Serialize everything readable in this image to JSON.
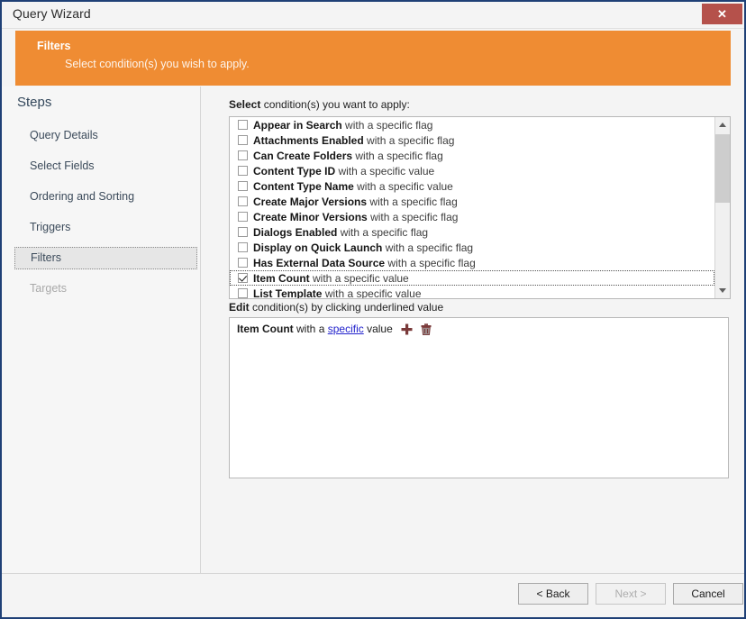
{
  "window": {
    "title": "Query Wizard",
    "close_label": "✕",
    "accent_orange": "#ef8c33",
    "frame_border": "#1f4076",
    "close_button_color": "#b5514b"
  },
  "banner": {
    "title": "Filters",
    "subtitle": "Select condition(s) you wish to apply."
  },
  "sidebar": {
    "heading": "Steps",
    "items": [
      {
        "label": "Query Details",
        "state": "normal"
      },
      {
        "label": "Select Fields",
        "state": "normal"
      },
      {
        "label": "Ordering and Sorting",
        "state": "normal"
      },
      {
        "label": "Triggers",
        "state": "normal"
      },
      {
        "label": "Filters",
        "state": "selected"
      },
      {
        "label": "Targets",
        "state": "disabled"
      }
    ]
  },
  "main": {
    "select_label_bold": "Select",
    "select_label_rest": " condition(s) you want to apply:",
    "edit_label_bold": "Edit",
    "edit_label_rest": " condition(s) by clicking underlined value",
    "conditions": [
      {
        "name": "Appear in Search",
        "tail": "with a specific flag",
        "checked": false,
        "focused": false
      },
      {
        "name": "Attachments Enabled",
        "tail": "with a specific flag",
        "checked": false,
        "focused": false
      },
      {
        "name": "Can Create Folders",
        "tail": "with a specific flag",
        "checked": false,
        "focused": false
      },
      {
        "name": "Content Type ID",
        "tail": "with a specific value",
        "checked": false,
        "focused": false
      },
      {
        "name": "Content Type Name",
        "tail": "with a specific value",
        "checked": false,
        "focused": false
      },
      {
        "name": "Create Major Versions",
        "tail": "with a specific flag",
        "checked": false,
        "focused": false
      },
      {
        "name": "Create Minor Versions",
        "tail": "with a specific flag",
        "checked": false,
        "focused": false
      },
      {
        "name": "Dialogs Enabled",
        "tail": "with a specific flag",
        "checked": false,
        "focused": false
      },
      {
        "name": "Display on Quick Launch",
        "tail": "with a specific flag",
        "checked": false,
        "focused": false
      },
      {
        "name": "Has External Data Source",
        "tail": "with a specific flag",
        "checked": false,
        "focused": false
      },
      {
        "name": "Item Count",
        "tail": "with a specific value",
        "checked": true,
        "focused": true
      },
      {
        "name": "List Template",
        "tail": "with a specific value",
        "checked": false,
        "focused": false
      }
    ],
    "edit_condition": {
      "name": "Item Count",
      "mid": "with a",
      "link": "specific",
      "tail": "value",
      "add_icon": "plus-icon",
      "delete_icon": "trash-icon",
      "link_color": "#2222cc",
      "icon_color": "#7a3a3a"
    },
    "scrollbar": {
      "up_icon": "chevron-up-icon",
      "down_icon": "chevron-down-icon"
    }
  },
  "footer": {
    "back_label": "< Back",
    "next_label": "Next >",
    "cancel_label": "Cancel",
    "next_disabled": true
  }
}
